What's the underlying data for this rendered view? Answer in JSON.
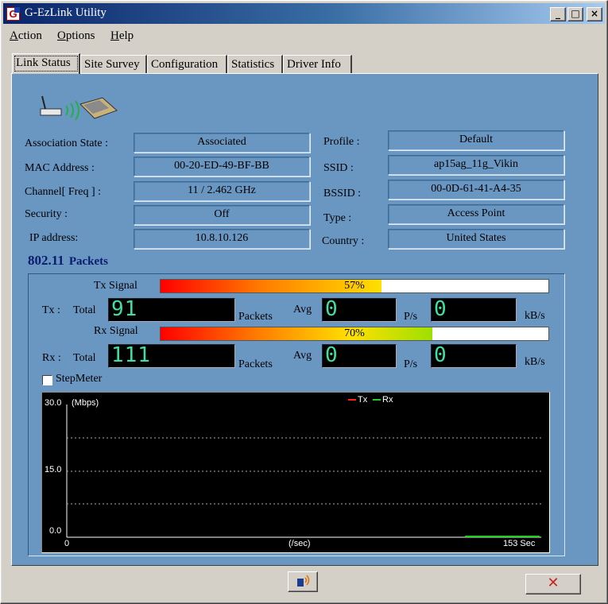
{
  "window": {
    "title": "G-EzLink Utility",
    "icon": "g-app-icon",
    "caption_buttons": [
      {
        "name": "minimize",
        "glyph": "_"
      },
      {
        "name": "maximize",
        "glyph": "□"
      },
      {
        "name": "close",
        "glyph": "×"
      }
    ]
  },
  "menu": [
    {
      "label_u": "A",
      "label_rest": "ction"
    },
    {
      "label_u": "O",
      "label_rest": "ptions"
    },
    {
      "label_u": "H",
      "label_rest": "elp"
    }
  ],
  "tabs": [
    "Link Status",
    "Site Survey",
    "Configuration",
    "Statistics",
    "Driver Info"
  ],
  "active_tab": "Link Status",
  "link_status": {
    "left": [
      {
        "label": "Association State :",
        "value": "Associated"
      },
      {
        "label": "MAC Address :",
        "value": "00-20-ED-49-BF-BB"
      },
      {
        "label": "Channel[ Freq ] :",
        "value": "11 / 2.462 GHz"
      },
      {
        "label": "Security :",
        "value": "Off"
      },
      {
        "label": "IP address:",
        "value": "10.8.10.126"
      }
    ],
    "right": [
      {
        "label": "Profile :",
        "value": "Default"
      },
      {
        "label": "SSID :",
        "value": "ap15ag_11g_Vikin"
      },
      {
        "label": "BSSID :",
        "value": "00-0D-61-41-A4-35"
      },
      {
        "label": "Type :",
        "value": "Access Point"
      },
      {
        "label": "Country :",
        "value": "United States"
      }
    ]
  },
  "packets": {
    "title_main": "802.11",
    "title_sub": "Packets",
    "tx_signal": {
      "label": "Tx Signal",
      "percent_text": "57%",
      "level": 0.57
    },
    "rx_signal": {
      "label": "Rx Signal",
      "percent_text": "70%",
      "level": 0.7
    },
    "tx": {
      "label": "Tx :",
      "total_label": "Total",
      "total": "91",
      "packets_label": "Packets",
      "avg_label": "Avg",
      "avg": "0",
      "ps_label": "P/s",
      "kbs": "0",
      "kbs_label": "kB/s"
    },
    "rx": {
      "label": "Rx :",
      "total_label": "Total",
      "total": "111",
      "packets_label": "Packets",
      "avg_label": "Avg",
      "avg": "0",
      "ps_label": "P/s",
      "kbs": "0",
      "kbs_label": "kB/s"
    },
    "stepmeter_label": "StepMeter",
    "stepmeter_checked": false
  },
  "graph": {
    "y_top": "30.0",
    "y_unit": "(Mbps)",
    "y_mid": "15.0",
    "y_bottom": "0.0",
    "x_start": "0",
    "x_unit": "(/sec)",
    "x_end": "153 Sec",
    "legend": [
      {
        "name": "Tx",
        "color": "#ff2020"
      },
      {
        "name": "Rx",
        "color": "#20d020"
      }
    ]
  },
  "bottom": {
    "connect_icon": "connect-icon",
    "close_icon": "close-icon"
  },
  "colors": {
    "panel": "#6a96c2",
    "title_dark": "#0a246a",
    "digital": "#3fe0a0"
  }
}
